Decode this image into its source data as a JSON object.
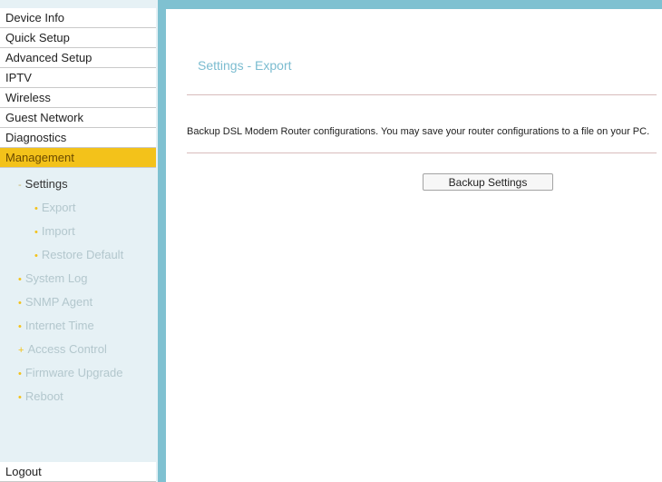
{
  "nav": {
    "main_items": [
      {
        "label": "Device Info"
      },
      {
        "label": "Quick Setup"
      },
      {
        "label": "Advanced Setup"
      },
      {
        "label": "IPTV"
      },
      {
        "label": "Wireless"
      },
      {
        "label": "Guest Network"
      },
      {
        "label": "Diagnostics"
      },
      {
        "label": "Management",
        "active": true
      }
    ],
    "sub_items": [
      {
        "label": "Settings",
        "current": true
      },
      {
        "label": "Export"
      },
      {
        "label": "Import"
      },
      {
        "label": "Restore Default"
      },
      {
        "label": "System Log"
      },
      {
        "label": "SNMP Agent"
      },
      {
        "label": "Internet Time"
      },
      {
        "label": "Access Control"
      },
      {
        "label": "Firmware Upgrade"
      },
      {
        "label": "Reboot"
      }
    ],
    "logout_label": "Logout"
  },
  "main": {
    "title": "Settings - Export",
    "description": "Backup DSL Modem Router configurations. You may save your router configurations to a file on your PC.",
    "backup_button_label": "Backup Settings"
  },
  "colors": {
    "accent_border": "#7fc1d1",
    "sidebar_bg": "#e6f1f5",
    "active_item": "#f3c21a",
    "title_text": "#7bbcd0"
  }
}
